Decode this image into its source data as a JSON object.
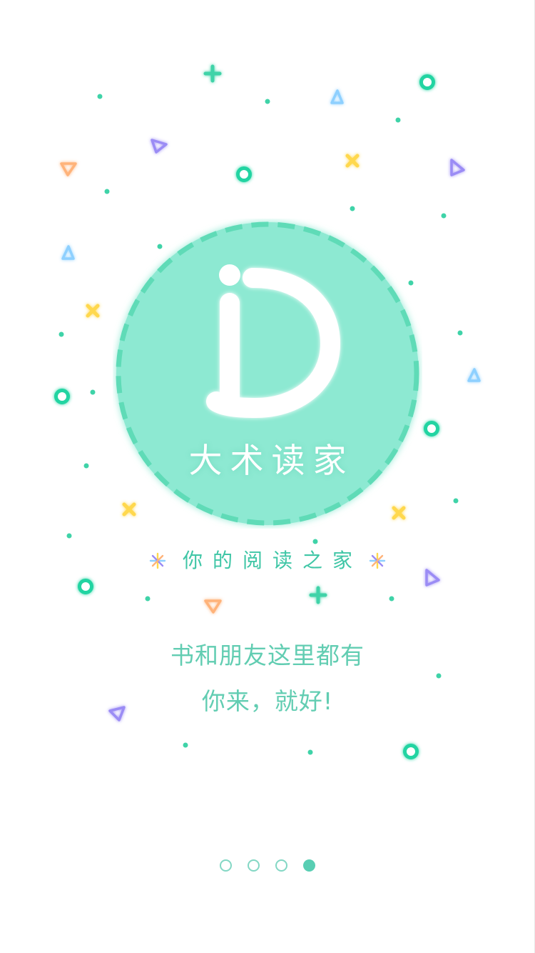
{
  "app": {
    "name": "大术读家"
  },
  "splash": {
    "tagline": "你的阅读之家",
    "slogan_line1": "书和朋友这里都有",
    "slogan_line2": "你来，就好!"
  },
  "pager": {
    "total": 4,
    "active_index": 3
  },
  "colors": {
    "accent": "#3fd3a8",
    "logo_fill": "#8de9d2",
    "logo_ring": "#5fdbb7",
    "text_teal": "#62cdb2",
    "tagline": "#3fc6a6",
    "orange": "#ffb37a",
    "yellow": "#ffd84d",
    "purple": "#9b8cf5",
    "blue": "#8ed0ff"
  },
  "icons": {
    "logo": "letter-id-logo-icon",
    "sparkle": "sparkle-icon"
  }
}
